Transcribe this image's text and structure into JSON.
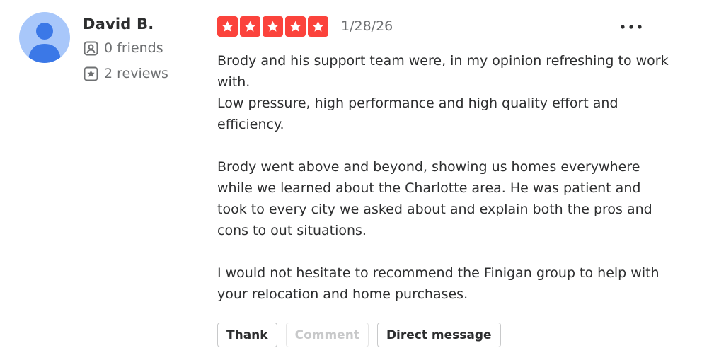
{
  "reviewer": {
    "name": "David B.",
    "friends": "0 friends",
    "reviews": "2 reviews"
  },
  "review": {
    "rating": 5,
    "max_rating": 5,
    "date": "1/28/26",
    "star_color": "#fb433c",
    "paragraphs": [
      "Brody and his support team were, in my opinion refreshing to work with.\nLow pressure, high performance and high quality effort and efficiency.",
      "Brody went above and beyond, showing us homes everywhere while we learned about the Charlotte area. He was patient and took to every city we asked about and explain both the pros and cons to out situations.",
      "I would not hesitate to recommend the Finigan group to help with your relocation and home purchases."
    ]
  },
  "actions": {
    "thank_label": "Thank",
    "comment_label": "Comment",
    "direct_message_label": "Direct message"
  },
  "icons": {
    "avatar": "person-icon",
    "friends": "friends-icon",
    "reviews": "review-star-icon",
    "more": "more-options-icon"
  }
}
